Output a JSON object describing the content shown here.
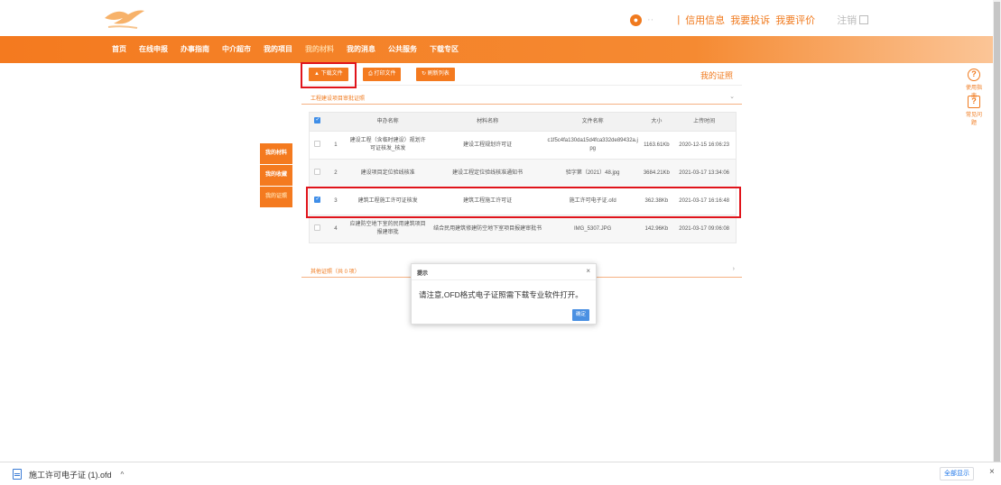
{
  "header": {
    "user_name": "··",
    "separator": "|",
    "links": [
      "信用信息",
      "我要投诉",
      "我要评价"
    ],
    "logout": "注销",
    "accent_color": "#f47a1f"
  },
  "nav": {
    "items": [
      "首页",
      "在线申报",
      "办事指南",
      "中介超市",
      "我的项目",
      "我的材料",
      "我的消息",
      "公共服务",
      "下载专区"
    ],
    "active_index": 5
  },
  "side_menu": {
    "items": [
      "我的材料",
      "我的收藏",
      "我的证照"
    ],
    "active_index": 2
  },
  "right_tools": [
    {
      "icon": "question-icon",
      "glyph": "?",
      "label": "使用指南"
    },
    {
      "icon": "faq-icon",
      "glyph": "?",
      "label": "常见问题"
    }
  ],
  "toolbar": {
    "download": "下载文件",
    "print": "打印文件",
    "refresh": "刷新列表",
    "page_title": "我的证照"
  },
  "accordion": {
    "top_title": "工程建设项目审批证照",
    "bottom_title": "其他证照（共 0 项）"
  },
  "table": {
    "headers": [
      "",
      "",
      "申办名称",
      "材料名称",
      "文件名称",
      "大小",
      "上传时间"
    ],
    "rows": [
      {
        "checked": false,
        "no": "1",
        "apply": "建设工程（含临时建设）规划许可证核发_核发",
        "material": "建设工程规划许可证",
        "file": "c1f5c4fa130da15d4fca332de89432a.jpg",
        "size": "1163.61Kb",
        "time": "2020-12-15 16:06:23"
      },
      {
        "checked": false,
        "no": "2",
        "apply": "建设项目定位验线核准",
        "material": "建设工程定位验线核准通知书",
        "file": "验字第（2021）48.jpg",
        "size": "3684.21Kb",
        "time": "2021-03-17 13:34:06"
      },
      {
        "checked": true,
        "no": "3",
        "apply": "建筑工程施工许可证核发",
        "material": "建筑工程施工许可证",
        "file": "施工许可电子证.ofd",
        "size": "362.38Kb",
        "time": "2021-03-17 16:16:48"
      },
      {
        "checked": false,
        "no": "4",
        "apply": "应建防空地下室的民用建筑项目报建审批",
        "material": "结合民用建筑修建防空地下室项目报建审批书",
        "file": "IMG_5307.JPG",
        "size": "142.96Kb",
        "time": "2021-03-17 09:06:08"
      }
    ]
  },
  "dialog": {
    "title": "提示",
    "message": "请注意,OFD格式电子证照需下载专业软件打开。",
    "ok": "确定",
    "close": "×"
  },
  "download_bar": {
    "filename": "施工许可电子证 (1).ofd",
    "caret": "^",
    "show_all": "全部显示",
    "close": "×"
  }
}
